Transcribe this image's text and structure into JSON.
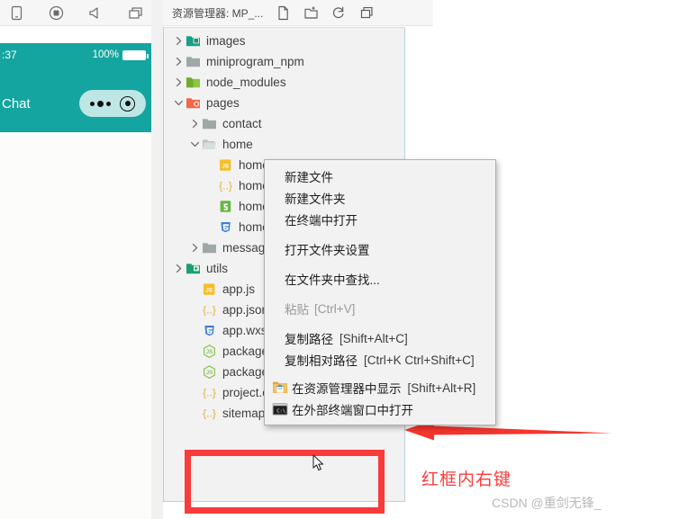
{
  "sim_toolbar": {
    "icons": [
      {
        "name": "phone-icon",
        "label": "Phone"
      },
      {
        "name": "record-icon",
        "label": "Record"
      },
      {
        "name": "sound-icon",
        "label": "Sound"
      },
      {
        "name": "window-icon",
        "label": "Window"
      }
    ]
  },
  "phone": {
    "time": ":37",
    "battery_percent": "100%",
    "nav_title": "Chat"
  },
  "explorer": {
    "title": "资源管理器: MP_...",
    "actions": [
      {
        "name": "new-file-icon",
        "label": "新建文件"
      },
      {
        "name": "new-folder-icon",
        "label": "新建文件夹"
      },
      {
        "name": "refresh-icon",
        "label": "刷新"
      },
      {
        "name": "collapse-all-icon",
        "label": "折叠全部"
      }
    ],
    "tree": [
      {
        "label": "images",
        "type": "folder",
        "icon": "folder-images-icon",
        "indent": 0,
        "expanded": false,
        "chevron": "right"
      },
      {
        "label": "miniprogram_npm",
        "type": "folder",
        "icon": "folder-gray-icon",
        "indent": 0,
        "expanded": false,
        "chevron": "right"
      },
      {
        "label": "node_modules",
        "type": "folder",
        "icon": "folder-node-icon",
        "indent": 0,
        "expanded": false,
        "chevron": "right"
      },
      {
        "label": "pages",
        "type": "folder",
        "icon": "folder-pages-icon",
        "indent": 0,
        "expanded": true,
        "chevron": "down"
      },
      {
        "label": "contact",
        "type": "folder",
        "icon": "folder-gray-icon",
        "indent": 1,
        "expanded": false,
        "chevron": "right"
      },
      {
        "label": "home",
        "type": "folder",
        "icon": "folder-open-icon",
        "indent": 1,
        "expanded": true,
        "chevron": "down"
      },
      {
        "label": "home.js",
        "type": "file",
        "icon": "js-file-icon",
        "indent": 2,
        "chevron": "none"
      },
      {
        "label": "home.json",
        "type": "file",
        "icon": "json-file-icon",
        "indent": 2,
        "chevron": "none"
      },
      {
        "label": "home.wxml",
        "type": "file",
        "icon": "wxml-file-icon",
        "indent": 2,
        "chevron": "none"
      },
      {
        "label": "home.wxss",
        "type": "file",
        "icon": "wxss-file-icon",
        "indent": 2,
        "chevron": "none"
      },
      {
        "label": "message",
        "type": "folder",
        "icon": "folder-gray-icon",
        "indent": 1,
        "expanded": false,
        "chevron": "right"
      },
      {
        "label": "utils",
        "type": "folder",
        "icon": "folder-utils-icon",
        "indent": 0,
        "expanded": false,
        "chevron": "right"
      },
      {
        "label": "app.js",
        "type": "file",
        "icon": "js-file-icon",
        "indent": 1,
        "chevron": "none"
      },
      {
        "label": "app.json",
        "type": "file",
        "icon": "json-file-icon",
        "indent": 1,
        "chevron": "none"
      },
      {
        "label": "app.wxss",
        "type": "file",
        "icon": "wxss-file-icon",
        "indent": 1,
        "chevron": "none"
      },
      {
        "label": "package.json",
        "type": "file",
        "icon": "node-file-icon",
        "indent": 1,
        "chevron": "none"
      },
      {
        "label": "package-lock.json",
        "type": "file",
        "icon": "node-file-icon",
        "indent": 1,
        "chevron": "none"
      },
      {
        "label": "project.config.json",
        "type": "file",
        "icon": "json-file-icon",
        "indent": 1,
        "chevron": "none"
      },
      {
        "label": "sitemap.json",
        "type": "file",
        "icon": "json-file-icon",
        "indent": 1,
        "chevron": "none"
      }
    ]
  },
  "context_menu": {
    "items": [
      {
        "label": "新建文件",
        "shortcut": "",
        "icon": "",
        "disabled": false
      },
      {
        "label": "新建文件夹",
        "shortcut": "",
        "icon": "",
        "disabled": false
      },
      {
        "label": "在终端中打开",
        "shortcut": "",
        "icon": "",
        "disabled": false
      },
      {
        "label": "打开文件夹设置",
        "shortcut": "",
        "icon": "",
        "disabled": false
      },
      {
        "label": "在文件夹中查找...",
        "shortcut": "",
        "icon": "",
        "disabled": false
      },
      {
        "label": "粘贴",
        "shortcut": "[Ctrl+V]",
        "icon": "",
        "disabled": true
      },
      {
        "label": "复制路径",
        "shortcut": "[Shift+Alt+C]",
        "icon": "",
        "disabled": false
      },
      {
        "label": "复制相对路径",
        "shortcut": "[Ctrl+K Ctrl+Shift+C]",
        "icon": "",
        "disabled": false
      },
      {
        "label": "在资源管理器中显示",
        "shortcut": "[Shift+Alt+R]",
        "icon": "explorer-folder-icon",
        "disabled": false
      },
      {
        "label": "在外部终端窗口中打开",
        "shortcut": "",
        "icon": "cmd-terminal-icon",
        "disabled": false
      }
    ]
  },
  "annotations": {
    "hint_text": "红框内右键",
    "watermark": "CSDN @重剑无锋_",
    "red_color": "#fa3b3b",
    "accent_teal": "#14a5a0"
  }
}
